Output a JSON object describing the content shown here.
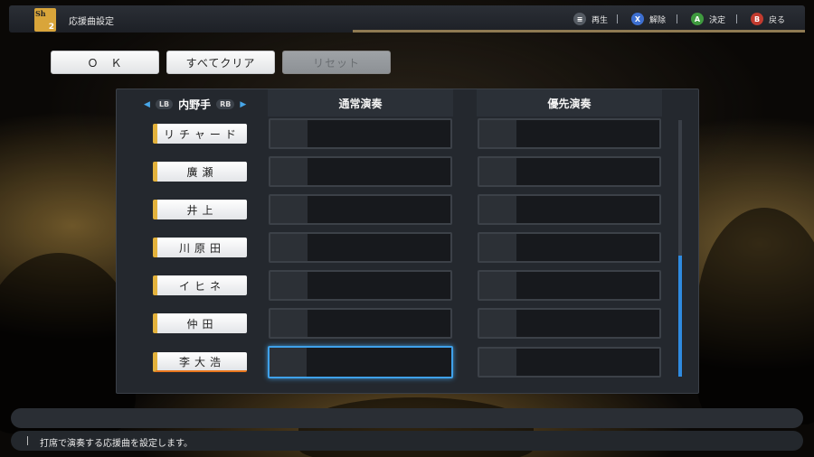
{
  "header": {
    "logo_letters": "Sh",
    "logo_number": "2",
    "title": "応援曲設定",
    "hints": [
      {
        "badge": "≡",
        "label": "再生"
      },
      {
        "badge": "X",
        "label": "解除"
      },
      {
        "badge": "A",
        "label": "決定"
      },
      {
        "badge": "B",
        "label": "戻る"
      }
    ]
  },
  "actions": {
    "ok": "Ｏ　Ｋ",
    "clear_all": "すべてクリア",
    "reset": "リセット"
  },
  "panel": {
    "selector": {
      "prev_button": "LB",
      "label": "内野手",
      "next_button": "RB"
    },
    "col_normal": "通常演奏",
    "col_priority": "優先演奏",
    "players": [
      "リチャード",
      "廣瀬",
      "井上",
      "川原田",
      "イヒネ",
      "仲田",
      "李大浩"
    ],
    "selected_index": 6,
    "scroll_position": 0.53
  },
  "footer": {
    "description": "打席で演奏する応援曲を設定します。"
  },
  "colors": {
    "accent_gold": "#e3b23c",
    "focus_blue": "#3fa1ea"
  }
}
